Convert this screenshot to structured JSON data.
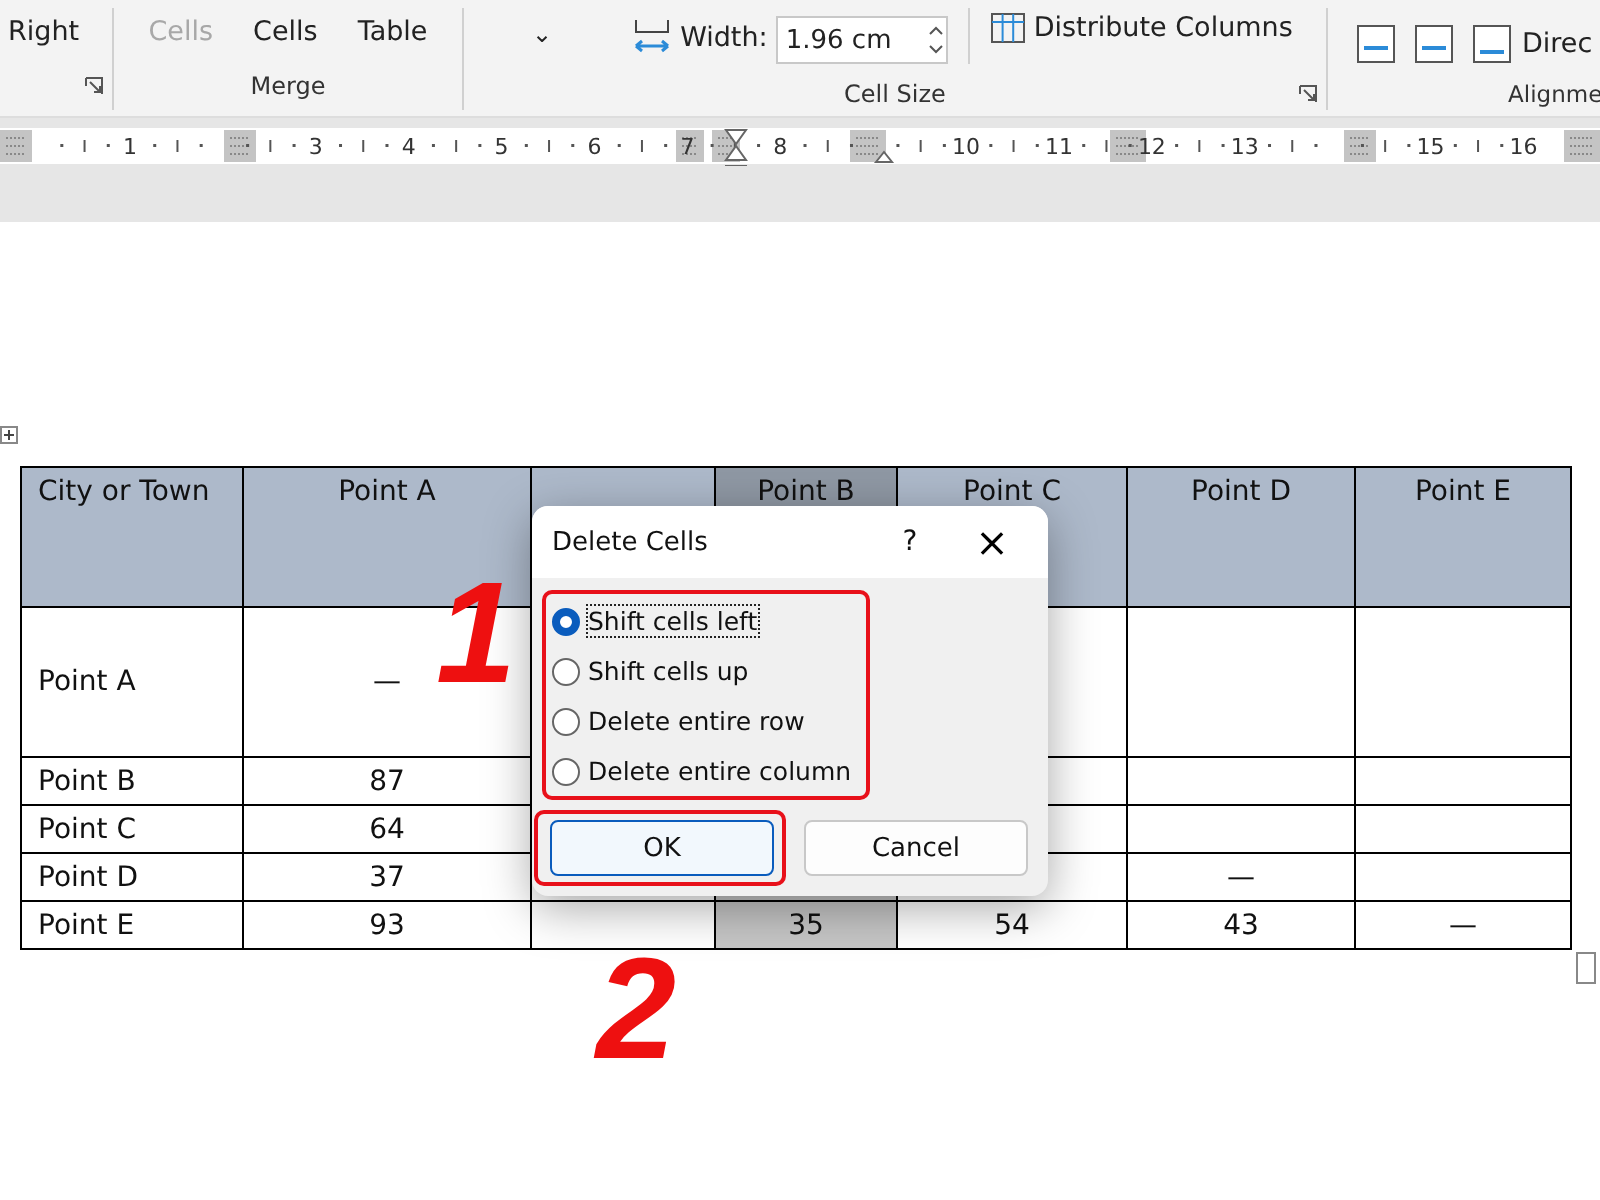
{
  "ribbon": {
    "groups": [
      {
        "kind": "stack",
        "buttons": [
          {
            "label": "Right",
            "disabled": false
          }
        ],
        "launcher": true
      },
      {
        "kind": "stack",
        "name": "Merge",
        "buttons": [
          {
            "label": "Cells",
            "disabled": true
          },
          {
            "label": "Cells",
            "disabled": false
          },
          {
            "label": "Table",
            "disabled": false
          }
        ],
        "launcher": false
      },
      {
        "kind": "size",
        "name": "Cell Size",
        "dropdown": "⌄",
        "width_label": "Width:",
        "width_value": "1.96 cm",
        "distribute": "Distribute Columns",
        "launcher": true
      },
      {
        "kind": "align",
        "name": "Alignme",
        "text": "Direc"
      }
    ]
  },
  "ruler": {
    "numbers": [
      "1",
      "3",
      "4",
      "5",
      "6",
      "7",
      "8",
      "10",
      "11",
      "12",
      "13",
      "15",
      "16"
    ]
  },
  "table": {
    "columns": [
      {
        "label": "City or Town",
        "selected": false
      },
      {
        "label": "Point A",
        "selected": false
      },
      {
        "selected": false
      },
      {
        "label": "Point B",
        "selected": true
      },
      {
        "label": "Point C",
        "selected": false
      },
      {
        "label": "Point D",
        "selected": false
      },
      {
        "label": "Point E",
        "selected": false
      }
    ],
    "rows": [
      {
        "cells": [
          "Point A",
          "—",
          "",
          "",
          "",
          "",
          ""
        ]
      },
      {
        "cells": [
          "Point B",
          "87",
          "",
          "",
          "",
          "",
          ""
        ]
      },
      {
        "cells": [
          "Point C",
          "64",
          "",
          "",
          "",
          "",
          ""
        ]
      },
      {
        "cells": [
          "Point D",
          "37",
          "",
          "",
          "",
          "—",
          ""
        ]
      },
      {
        "cells": [
          "Point E",
          "93",
          "",
          "35",
          "54",
          "43",
          "—"
        ]
      }
    ]
  },
  "dialog": {
    "title": "Delete Cells",
    "help": "?",
    "close": "×",
    "options": [
      {
        "label": "Shift cells left",
        "selected": true,
        "focused": true
      },
      {
        "label": "Shift cells up",
        "selected": false,
        "focused": false
      },
      {
        "label": "Delete entire row",
        "selected": false,
        "focused": false
      },
      {
        "label": "Delete entire column",
        "selected": false,
        "focused": false
      }
    ],
    "buttons": [
      {
        "label": "OK",
        "default": true
      },
      {
        "label": "Cancel",
        "default": false
      }
    ]
  },
  "annotations": [
    {
      "label": "1"
    },
    {
      "label": "2"
    }
  ]
}
